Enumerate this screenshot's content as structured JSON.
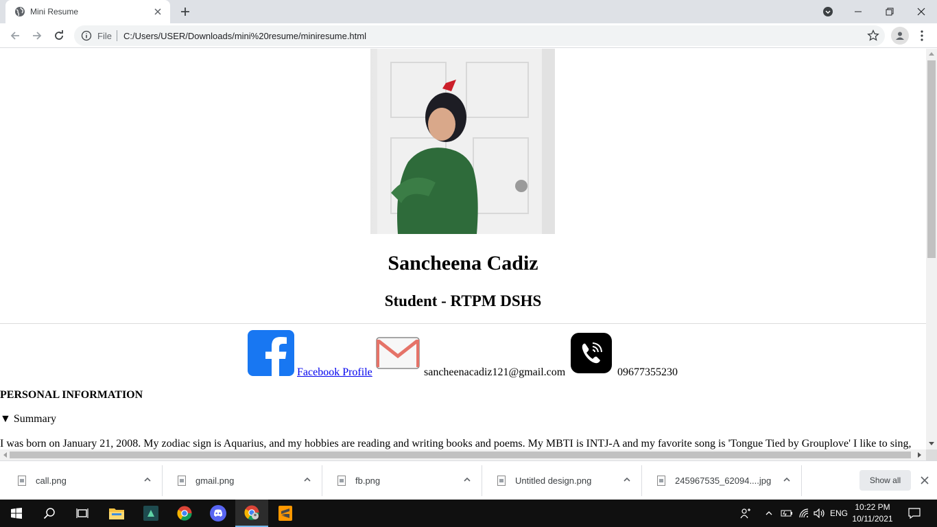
{
  "browser": {
    "tab_title": "Mini Resume",
    "address_scheme": "File",
    "address_url": "C:/Users/USER/Downloads/mini%20resume/miniresume.html"
  },
  "page": {
    "name": "Sancheena Cadiz",
    "role": "Student - RTPM DSHS",
    "facebook_label": "Facebook Profile",
    "email": "sancheenacadiz121@gmail.com",
    "phone": "09677355230",
    "section_heading": "PERSONAL INFORMATION",
    "summary_label": "▼ Summary",
    "bio": "I was born on January 21, 2008. My zodiac sign is Aquarius, and my hobbies are reading and writing books and poems. My MBTI is INTJ-A and my favorite song is 'Tongue Tied by Grouplove' I like to sing,"
  },
  "downloads": {
    "items": [
      "call.png",
      "gmail.png",
      "fb.png",
      "Untitled design.png",
      "245967535_62094....jpg"
    ],
    "show_all_label": "Show all"
  },
  "taskbar": {
    "language": "ENG",
    "time": "10:22 PM",
    "date": "10/11/2021"
  },
  "colors": {
    "facebook_blue": "#1877f2",
    "link_blue": "#0000ee",
    "chrome_tabstrip": "#dee1e6",
    "taskbar": "#101010"
  }
}
